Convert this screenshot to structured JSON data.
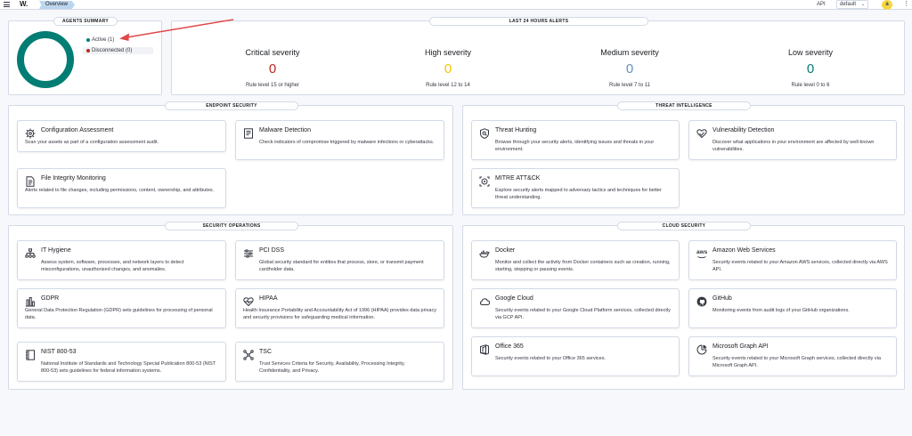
{
  "header": {
    "logo": "W.",
    "breadcrumb": "Overview",
    "api": "API",
    "context": "default",
    "avatar": "a",
    "menu_glyph": "⋮"
  },
  "agents": {
    "title": "AGENTS SUMMARY",
    "active": "Active (1)",
    "disconnected": "Disconnected (0)",
    "colors": {
      "active": "#017d73",
      "disconnected": "#bd271e"
    }
  },
  "alerts": {
    "title": "LAST 24 HOURS ALERTS",
    "items": [
      {
        "label": "Critical severity",
        "value": "0",
        "sub": "Rule level 15 or higher",
        "color": "#bd271e"
      },
      {
        "label": "High severity",
        "value": "0",
        "sub": "Rule level 12 to 14",
        "color": "#f5a700"
      },
      {
        "label": "Medium severity",
        "value": "0",
        "sub": "Rule level 7 to 11",
        "color": "#6092c0"
      },
      {
        "label": "Low severity",
        "value": "0",
        "sub": "Rule level 0 to 6",
        "color": "#017d73"
      }
    ]
  },
  "sections": {
    "endpoint": {
      "title": "ENDPOINT SECURITY",
      "cards": [
        {
          "title": "Configuration Assessment",
          "desc": "Scan your assets as part of a configuration assessment audit.",
          "icon": "gear-icon"
        },
        {
          "title": "Malware Detection",
          "desc": "Check indicators of compromise triggered by malware infections or cyberattacks.",
          "icon": "document-icon"
        },
        {
          "title": "File Integrity Monitoring",
          "desc": "Alerts related to file changes, including permissions, content, ownership, and attributes.",
          "icon": "file-icon"
        }
      ]
    },
    "threat": {
      "title": "THREAT INTELLIGENCE",
      "cards": [
        {
          "title": "Threat Hunting",
          "desc": "Browse through your security alerts, identifying issues and threats in your environment.",
          "icon": "shield-search-icon"
        },
        {
          "title": "Vulnerability Detection",
          "desc": "Discover what applications in your environment are affected by well-known vulnerabilities.",
          "icon": "heart-icon"
        },
        {
          "title": "MITRE ATT&CK",
          "desc": "Explore security alerts mapped to adversary tactics and techniques for better threat understanding.",
          "icon": "target-icon"
        }
      ]
    },
    "secops": {
      "title": "SECURITY OPERATIONS",
      "cards": [
        {
          "title": "IT Hygiene",
          "desc": "Assess system, software, processes, and network layers to detect misconfigurations, unauthorized changes, and anomalies.",
          "icon": "network-icon"
        },
        {
          "title": "PCI DSS",
          "desc": "Global security standard for entities that process, store, or transmit payment cardholder data.",
          "icon": "sliders-icon"
        },
        {
          "title": "GDPR",
          "desc": "General Data Protection Regulation (GDPR) sets guidelines for processing of personal data.",
          "icon": "bar-chart-icon"
        },
        {
          "title": "HIPAA",
          "desc": "Health Insurance Portability and Accountability Act of 1996 (HIPAA) provides data privacy and security provisions for safeguarding medical information.",
          "icon": "health-icon"
        },
        {
          "title": "NIST 800-53",
          "desc": "National Institute of Standards and Technology Special Publication 800-53 (NIST 800-53) sets guidelines for federal information systems.",
          "icon": "notebook-icon"
        },
        {
          "title": "TSC",
          "desc": "Trust Services Criteria for Security, Availability, Processing Integrity, Confidentiality, and Privacy.",
          "icon": "nodes-icon"
        }
      ]
    },
    "cloud": {
      "title": "CLOUD SECURITY",
      "cards": [
        {
          "title": "Docker",
          "desc": "Monitor and collect the activity from Docker containers such as creation, running, starting, stopping or pausing events.",
          "icon": "docker-icon"
        },
        {
          "title": "Amazon Web Services",
          "desc": "Security events related to your Amazon AWS services, collected directly via AWS API.",
          "icon": "aws-icon",
          "icon_text": "aws"
        },
        {
          "title": "Google Cloud",
          "desc": "Security events related to your Google Cloud Platform services, collected directly via GCP API.",
          "icon": "google-cloud-icon"
        },
        {
          "title": "GitHub",
          "desc": "Monitoring events from audit logs of your GitHub organizations.",
          "icon": "github-icon"
        },
        {
          "title": "Office 365",
          "desc": "Security events related to your Office 365 services.",
          "icon": "office365-icon"
        },
        {
          "title": "Microsoft Graph API",
          "desc": "Security events related to your Microsoft Graph services, collected directly via Microsoft Graph API.",
          "icon": "microsoft-graph-icon"
        }
      ]
    }
  }
}
